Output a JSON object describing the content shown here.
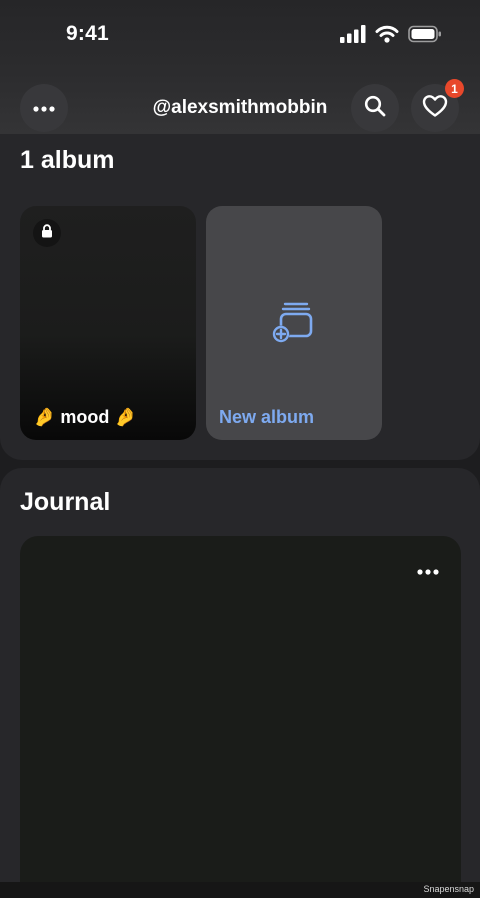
{
  "status_bar": {
    "time": "9:41",
    "icons": [
      "signal-icon",
      "wifi-icon",
      "battery-icon"
    ]
  },
  "header": {
    "username": "@alexsmithmobbin",
    "more_icon": "more-horizontal-icon",
    "search_icon": "search-icon",
    "activity_icon": "heart-icon",
    "notification_count": "1"
  },
  "albums": {
    "title": "1 album",
    "items": [
      {
        "label": "🤌 mood 🤌",
        "locked": true,
        "icon": "lock-icon"
      }
    ],
    "new_album": {
      "label": "New album",
      "icon": "stack-add-icon"
    }
  },
  "journal": {
    "title": "Journal",
    "more_icon": "more-horizontal-icon"
  },
  "watermark": "Snapensnap",
  "colors": {
    "background": "#1d1d1f",
    "section": "#27272a",
    "accent_blue": "#7eaaf0",
    "badge_red": "#e8482b"
  }
}
